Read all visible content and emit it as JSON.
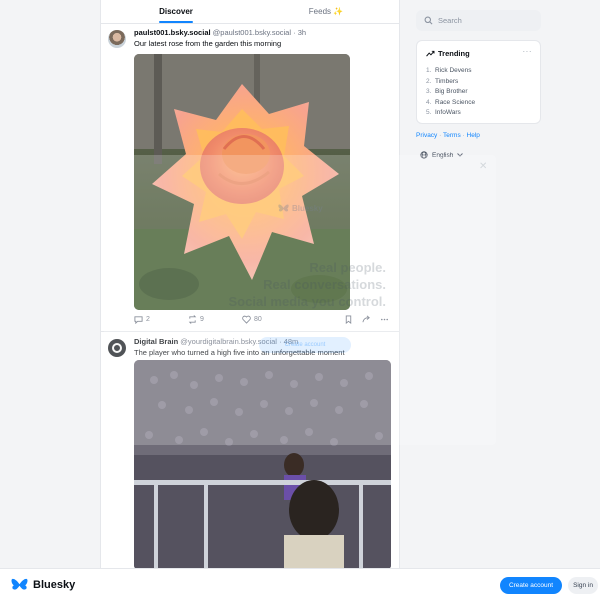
{
  "tabs": [
    {
      "label": "Discover",
      "active": true
    },
    {
      "label": "Feeds ✨",
      "active": false
    }
  ],
  "posts": [
    {
      "name": "paulst001.bsky.social",
      "handle": "@paulst001.bsky.social",
      "time": "3h",
      "text": "Our latest rose from the garden this morning",
      "replies": "2",
      "reposts": "9",
      "likes": "80"
    },
    {
      "name": "Digital Brain",
      "handle": "@yourdigitalbrain.bsky.social",
      "time": "48m",
      "text": "The player who turned a high five into an unforgettable moment"
    }
  ],
  "search": {
    "placeholder": "Search"
  },
  "trending": {
    "title": "Trending",
    "items": [
      {
        "num": "1.",
        "label": "Rick Devens"
      },
      {
        "num": "2.",
        "label": "Timbers"
      },
      {
        "num": "3.",
        "label": "Big Brother"
      },
      {
        "num": "4.",
        "label": "Race Science"
      },
      {
        "num": "5.",
        "label": "InfoWars"
      }
    ]
  },
  "footer_links": {
    "privacy": "Privacy",
    "terms": "Terms",
    "help": "Help",
    "sep": "·"
  },
  "language": "English",
  "overlay": {
    "logo": "Bluesky",
    "line1": "Real people.",
    "line2": "Real conversations.",
    "line3": "Social media you control.",
    "button": "Create account"
  },
  "bottom": {
    "brand": "Bluesky",
    "create_account": "Create account",
    "sign_in": "Sign in"
  },
  "colors": {
    "accent": "#1185fe",
    "muted": "#6b7280",
    "border": "#e5e7eb"
  },
  "icons": [
    "search-icon",
    "trending-icon",
    "more-icon",
    "globe-icon",
    "chevron-down-icon",
    "reply-icon",
    "repost-icon",
    "like-icon",
    "bookmark-icon",
    "share-icon",
    "butterfly-icon",
    "close-icon"
  ]
}
